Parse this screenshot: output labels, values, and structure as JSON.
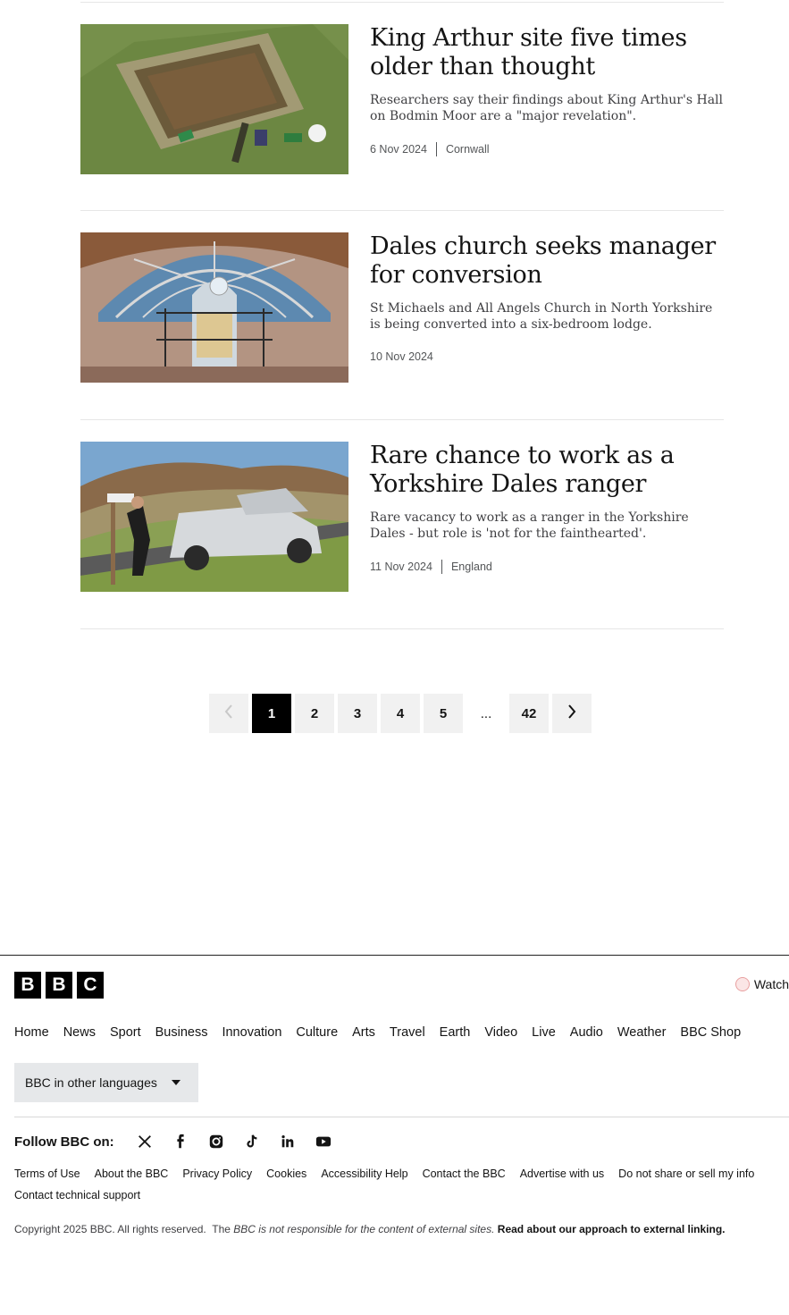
{
  "articles": [
    {
      "headline": "King Arthur site five times older than thought",
      "summary": "Researchers say their findings about King Arthur's Hall on Bodmin Moor are a \"major revelation\".",
      "date": "6 Nov 2024",
      "tag": "Cornwall"
    },
    {
      "headline": "Dales church seeks manager for conversion",
      "summary": "St Michaels and All Angels Church in North Yorkshire is being converted into a six-bedroom lodge.",
      "date": "10 Nov 2024",
      "tag": ""
    },
    {
      "headline": "Rare chance to work as a Yorkshire Dales ranger",
      "summary": "Rare vacancy to work as a ranger in the Yorkshire Dales - but role is 'not for the fainthearted'.",
      "date": "11 Nov 2024",
      "tag": "England"
    }
  ],
  "pagination": {
    "prev_icon": "chevron-left-icon",
    "pages": [
      "1",
      "2",
      "3",
      "4",
      "5"
    ],
    "current": "1",
    "ellipsis": "...",
    "last": "42",
    "next_icon": "chevron-right-icon"
  },
  "footer": {
    "logo": [
      "B",
      "B",
      "C"
    ],
    "watch_label": "Watch",
    "nav": [
      "Home",
      "News",
      "Sport",
      "Business",
      "Innovation",
      "Culture",
      "Arts",
      "Travel",
      "Earth",
      "Video",
      "Live",
      "Audio",
      "Weather",
      "BBC Shop"
    ],
    "languages_label": "BBC in other languages",
    "follow_label": "Follow BBC on:",
    "socials": [
      "x-icon",
      "facebook-icon",
      "instagram-icon",
      "tiktok-icon",
      "linkedin-icon",
      "youtube-icon"
    ],
    "legal_links": [
      "Terms of Use",
      "About the BBC",
      "Privacy Policy",
      "Cookies",
      "Accessibility Help",
      "Contact the BBC",
      "Advertise with us",
      "Do not share or sell my info",
      "Contact technical support"
    ],
    "copyright": "Copyright 2025 BBC. All rights reserved.",
    "external_prefix": "The",
    "external_bbc": "BBC",
    "external_note": "is not responsible for the content of external sites.",
    "external_link": "Read about our approach to external linking."
  }
}
